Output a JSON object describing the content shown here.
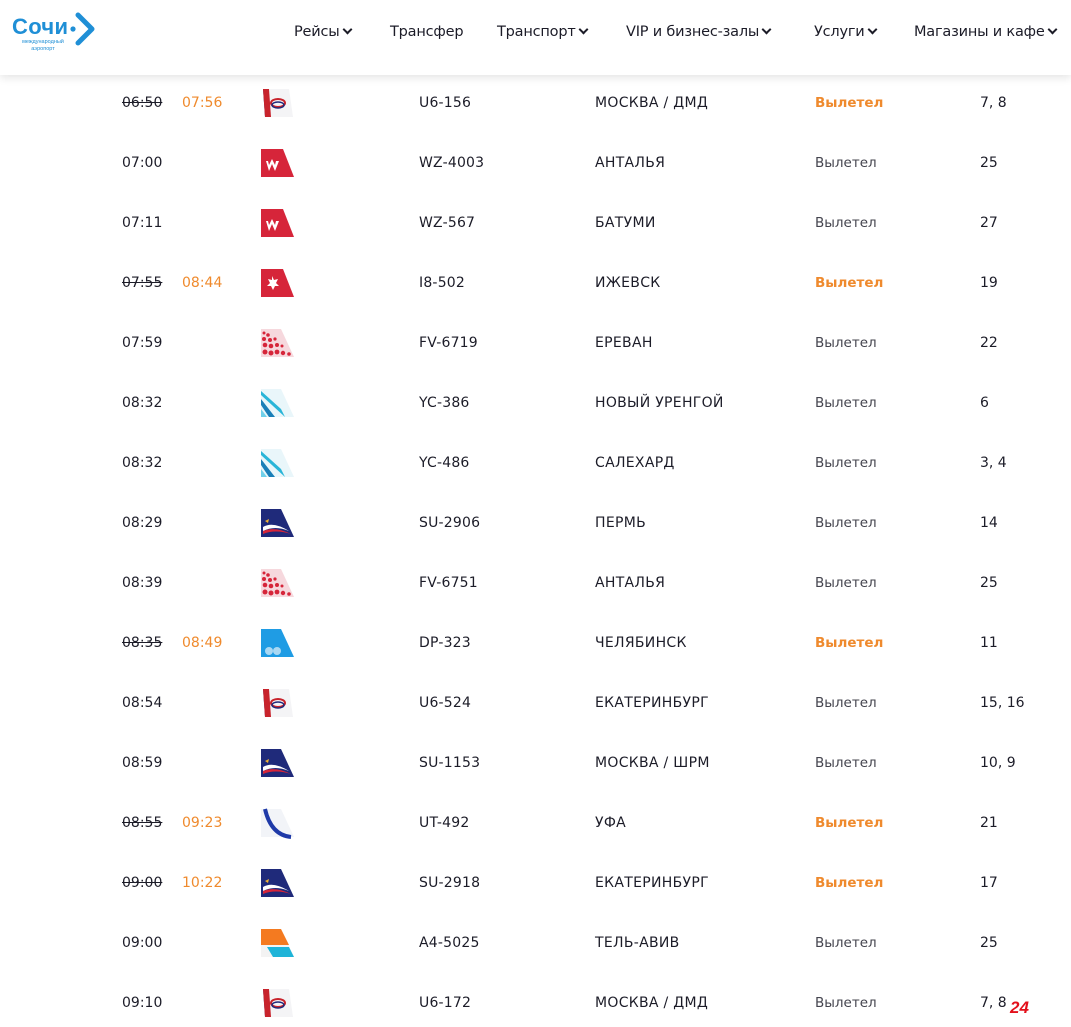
{
  "header": {
    "logo_word": "Сочи",
    "logo_sub": "международный аэропорт",
    "nav": [
      {
        "label": "Рейсы",
        "dropdown": true
      },
      {
        "label": "Трансфер",
        "dropdown": false
      },
      {
        "label": "Транспорт",
        "dropdown": true
      },
      {
        "label": "VIP и бизнес-залы",
        "dropdown": true
      },
      {
        "label": "Услуги",
        "dropdown": true
      },
      {
        "label": "Магазины и кафе",
        "dropdown": true
      }
    ]
  },
  "colors": {
    "accent_orange": "#ef8a2d",
    "brand_blue": "#1f8fd6",
    "text": "#1c1c28"
  },
  "flights": [
    {
      "sched": "06:50",
      "actual": "07:56",
      "airline_icon": "ural-airlines-tail-icon",
      "flight": "U6-156",
      "dest": "МОСКВА / ДМД",
      "status": "Вылетел",
      "highlight": true,
      "gate": "7, 8"
    },
    {
      "sched": "07:00",
      "actual": "",
      "airline_icon": "nordwind-tail-icon",
      "flight": "WZ-4003",
      "dest": "АНТАЛЬЯ",
      "status": "Вылетел",
      "highlight": false,
      "gate": "25"
    },
    {
      "sched": "07:11",
      "actual": "",
      "airline_icon": "nordwind-tail-icon",
      "flight": "WZ-567",
      "dest": "БАТУМИ",
      "status": "Вылетел",
      "highlight": false,
      "gate": "27"
    },
    {
      "sched": "07:55",
      "actual": "08:44",
      "airline_icon": "izhavia-tail-icon",
      "flight": "I8-502",
      "dest": "ИЖЕВСК",
      "status": "Вылетел",
      "highlight": true,
      "gate": "19"
    },
    {
      "sched": "07:59",
      "actual": "",
      "airline_icon": "rossiya-tail-icon",
      "flight": "FV-6719",
      "dest": "ЕРЕВАН",
      "status": "Вылетел",
      "highlight": false,
      "gate": "22"
    },
    {
      "sched": "08:32",
      "actual": "",
      "airline_icon": "yamal-tail-icon",
      "flight": "YC-386",
      "dest": "НОВЫЙ УРЕНГОЙ",
      "status": "Вылетел",
      "highlight": false,
      "gate": "6"
    },
    {
      "sched": "08:32",
      "actual": "",
      "airline_icon": "yamal-tail-icon",
      "flight": "YC-486",
      "dest": "САЛЕХАРД",
      "status": "Вылетел",
      "highlight": false,
      "gate": "3, 4"
    },
    {
      "sched": "08:29",
      "actual": "",
      "airline_icon": "aeroflot-tail-icon",
      "flight": "SU-2906",
      "dest": "ПЕРМЬ",
      "status": "Вылетел",
      "highlight": false,
      "gate": "14"
    },
    {
      "sched": "08:39",
      "actual": "",
      "airline_icon": "rossiya-tail-icon",
      "flight": "FV-6751",
      "dest": "АНТАЛЬЯ",
      "status": "Вылетел",
      "highlight": false,
      "gate": "25"
    },
    {
      "sched": "08:35",
      "actual": "08:49",
      "airline_icon": "pobeda-tail-icon",
      "flight": "DP-323",
      "dest": "ЧЕЛЯБИНСК",
      "status": "Вылетел",
      "highlight": true,
      "gate": "11"
    },
    {
      "sched": "08:54",
      "actual": "",
      "airline_icon": "ural-airlines-tail-icon",
      "flight": "U6-524",
      "dest": "ЕКАТЕРИНБУРГ",
      "status": "Вылетел",
      "highlight": false,
      "gate": "15, 16"
    },
    {
      "sched": "08:59",
      "actual": "",
      "airline_icon": "aeroflot-tail-icon",
      "flight": "SU-1153",
      "dest": "МОСКВА / ШРМ",
      "status": "Вылетел",
      "highlight": false,
      "gate": "10, 9"
    },
    {
      "sched": "08:55",
      "actual": "09:23",
      "airline_icon": "utair-tail-icon",
      "flight": "UT-492",
      "dest": "УФА",
      "status": "Вылетел",
      "highlight": true,
      "gate": "21"
    },
    {
      "sched": "09:00",
      "actual": "10:22",
      "airline_icon": "aeroflot-tail-icon",
      "flight": "SU-2918",
      "dest": "ЕКАТЕРИНБУРГ",
      "status": "Вылетел",
      "highlight": true,
      "gate": "17"
    },
    {
      "sched": "09:00",
      "actual": "",
      "airline_icon": "azur-air-tail-icon",
      "flight": "A4-5025",
      "dest": "ТЕЛЬ-АВИВ",
      "status": "Вылетел",
      "highlight": false,
      "gate": "25"
    },
    {
      "sched": "09:10",
      "actual": "",
      "airline_icon": "ural-airlines-tail-icon",
      "flight": "U6-172",
      "dest": "МОСКВА / ДМД",
      "status": "Вылетел",
      "highlight": false,
      "gate": "7, 8"
    }
  ],
  "watermark": "24"
}
